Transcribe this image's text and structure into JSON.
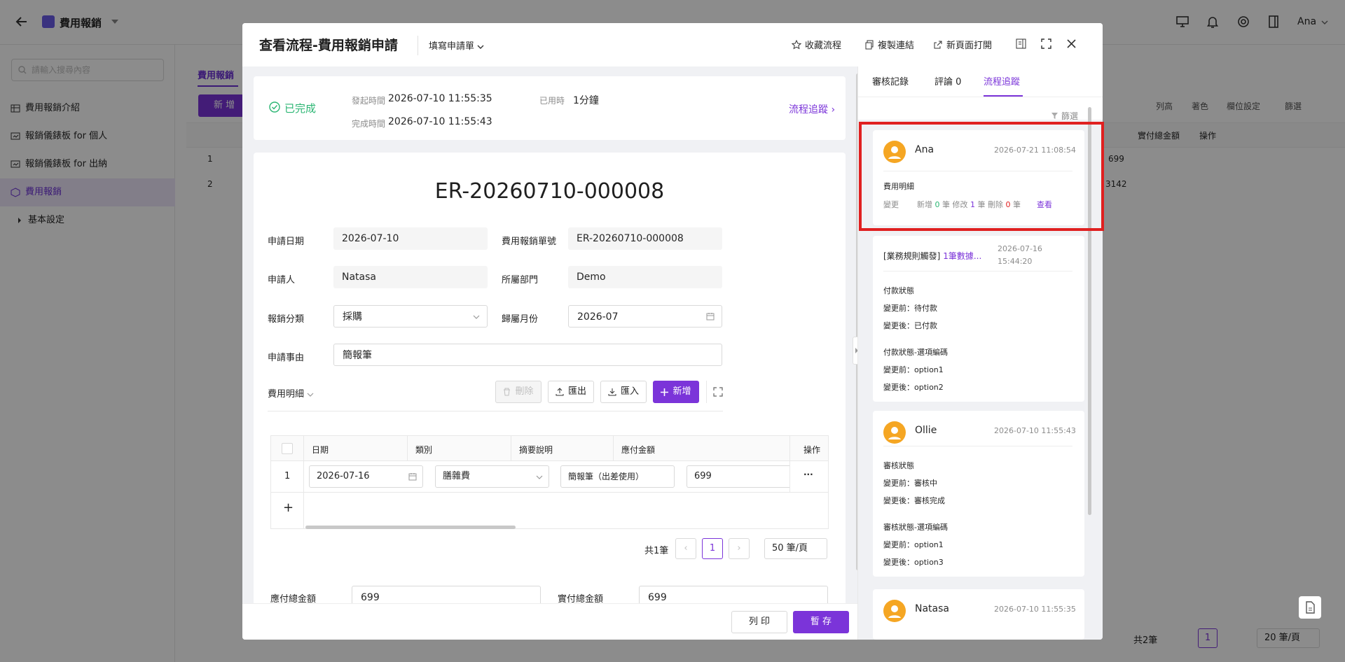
{
  "app": {
    "title": "費用報銷",
    "user": "Ana",
    "search_placeholder": "請輸入搜尋內容",
    "nav": [
      {
        "label": "費用報銷介紹"
      },
      {
        "label": "報銷儀錶板 for 個人"
      },
      {
        "label": "報銷儀錶板 for 出納"
      },
      {
        "label": "費用報銷"
      },
      {
        "label": "基本設定"
      }
    ],
    "bg_tab": "費用報銷",
    "bg_add": "新 增",
    "bg_rows": [
      "1",
      "2"
    ],
    "bg_col_paid": "實付總金額",
    "bg_col_action": "操作",
    "bg_cell1": "699",
    "bg_cell2": "3142",
    "bg_toolbar": [
      "列高",
      "著色",
      "欄位設定",
      "篩選"
    ],
    "bg_pager": {
      "total": "共2筆",
      "page": "1",
      "size": "20 筆/頁"
    }
  },
  "modal": {
    "title": "查看流程-費用報銷申請",
    "fill_form": "填寫申請單",
    "actions": [
      "收藏流程",
      "複製連結",
      "新頁面打開"
    ]
  },
  "status": {
    "state": "已完成",
    "start_label": "發起時間",
    "start_value": "2026-07-10 11:55:35",
    "used_label": "已用時",
    "used_value": "1分鐘",
    "end_label": "完成時間",
    "end_value": "2026-07-10 11:55:43",
    "trace_link": "流程追蹤"
  },
  "form": {
    "doc_no": "ER-20260710-000008",
    "apply_date_label": "申請日期",
    "apply_date": "2026-07-10",
    "expense_no_label": "費用報銷單號",
    "expense_no": "ER-20260710-000008",
    "applicant_label": "申請人",
    "applicant": "Natasa",
    "dept_label": "所屬部門",
    "dept": "Demo",
    "category_label": "報銷分類",
    "category": "採購",
    "month_label": "歸屬月份",
    "month": "2026-07",
    "reason_label": "申請事由",
    "reason": "簡報筆",
    "payable_label": "應付總金額",
    "payable": "699",
    "paid_label": "實付總金額",
    "paid": "699"
  },
  "detail": {
    "title": "費用明細",
    "delete": "刪除",
    "export": "匯出",
    "import": "匯入",
    "add": "新增",
    "columns": [
      "日期",
      "類別",
      "摘要說明",
      "應付金額",
      "操作"
    ],
    "rows": [
      {
        "no": "1",
        "date": "2026-07-16",
        "type": "膳雜費",
        "summary": "簡報筆（出差使用）",
        "amount": "699",
        "more": "···"
      }
    ],
    "add_row": "+",
    "pager": {
      "total": "共1筆",
      "page": "1",
      "size": "50 筆/頁"
    }
  },
  "footer": {
    "print": "列 印",
    "save": "暫 存"
  },
  "side": {
    "tabs": [
      "審核記錄",
      "評論 0",
      "流程追蹤"
    ],
    "filter": "篩選",
    "entries": [
      {
        "user": "Ana",
        "time": "2026-07-21 11:08:54",
        "section": "費用明細",
        "change_label": "變更",
        "add_text": "新增",
        "add_n": "0",
        "mod_text": "筆 修改",
        "mod_n": "1",
        "del_text": "筆 刪除",
        "del_n": "0",
        "tail": "筆",
        "view": "查看"
      },
      {
        "title_prefix": "[業務規則觸發]",
        "title_link": "1筆數據...",
        "time_line1": "2026-07-16",
        "time_line2": "15:44:20",
        "f1": "付款狀態",
        "f1_before": "變更前：待付款",
        "f1_after": "變更後：已付款",
        "f2": "付款狀態-選項編碼",
        "f2_before": "變更前：option1",
        "f2_after": "變更後：option2"
      },
      {
        "user": "Ollie",
        "time": "2026-07-10 11:55:43",
        "f1": "審核狀態",
        "f1_before": "變更前：審核中",
        "f1_after": "變更後：審核完成",
        "f2": "審核狀態-選項編碼",
        "f2_before": "變更前：option1",
        "f2_after": "變更後：option3"
      },
      {
        "user": "Natasa",
        "time": "2026-07-10 11:55:35"
      }
    ]
  },
  "colors": {
    "accent": "#7b34d9",
    "success": "#2bb673",
    "highlight": "#e02020",
    "avatar": "#f5a623"
  }
}
